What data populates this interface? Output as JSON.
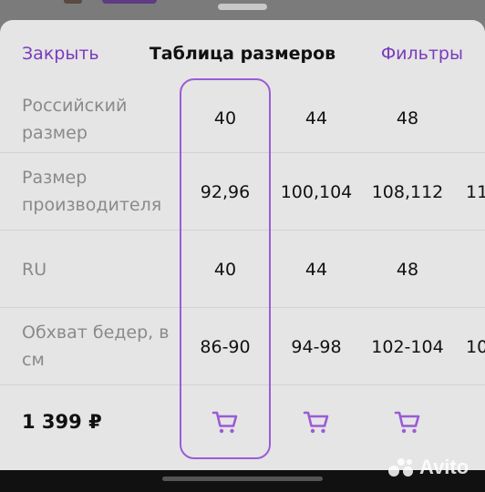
{
  "header": {
    "close_label": "Закрыть",
    "title": "Таблица размеров",
    "filters_label": "Фильтры"
  },
  "rows": [
    {
      "label": "Российский размер",
      "values": [
        "40",
        "44",
        "48",
        ""
      ]
    },
    {
      "label": "Размер производителя",
      "values": [
        "92,96",
        "100,104",
        "108,112",
        "11"
      ]
    },
    {
      "label": "RU",
      "values": [
        "40",
        "44",
        "48",
        ""
      ]
    },
    {
      "label": "Обхват бедер, в см",
      "values": [
        "86-90",
        "94-98",
        "102-104",
        "10"
      ]
    }
  ],
  "footer": {
    "price": "1 399 ₽"
  },
  "colors": {
    "accent": "#9a5cd6",
    "link": "#7a3bbd",
    "label": "#8a8a8a"
  },
  "icons": {
    "cart": "shopping-cart-icon"
  },
  "watermark": {
    "text": "Avito"
  }
}
